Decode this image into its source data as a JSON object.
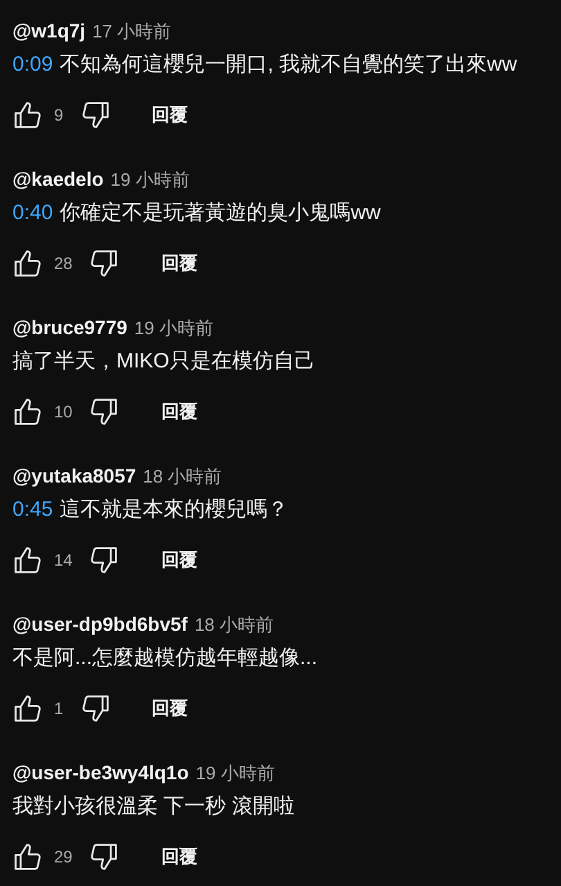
{
  "comments": [
    {
      "author": "@w1q7j",
      "time": "17 小時前",
      "timestamp": "0:09",
      "text": "不知為何這櫻兒一開口, 我就不自覺的笑了出來ww",
      "likes": "9",
      "reply": "回覆"
    },
    {
      "author": "@kaedelo",
      "time": "19 小時前",
      "timestamp": "0:40",
      "text": "你確定不是玩著黃遊的臭小鬼嗎ww",
      "likes": "28",
      "reply": "回覆"
    },
    {
      "author": "@bruce9779",
      "time": "19 小時前",
      "text": "搞了半天，MIKO只是在模仿自己",
      "likes": "10",
      "reply": "回覆"
    },
    {
      "author": "@yutaka8057",
      "time": "18 小時前",
      "timestamp": "0:45",
      "text": "這不就是本來的櫻兒嗎？",
      "likes": "14",
      "reply": "回覆"
    },
    {
      "author": "@user-dp9bd6bv5f",
      "time": "18 小時前",
      "text": "不是阿...怎麼越模仿越年輕越像...",
      "likes": "1",
      "reply": "回覆"
    },
    {
      "author": "@user-be3wy4lq1o",
      "time": "19 小時前",
      "text": "我對小孩很溫柔  下一秒 滾開啦",
      "likes": "29",
      "reply": "回覆"
    }
  ]
}
